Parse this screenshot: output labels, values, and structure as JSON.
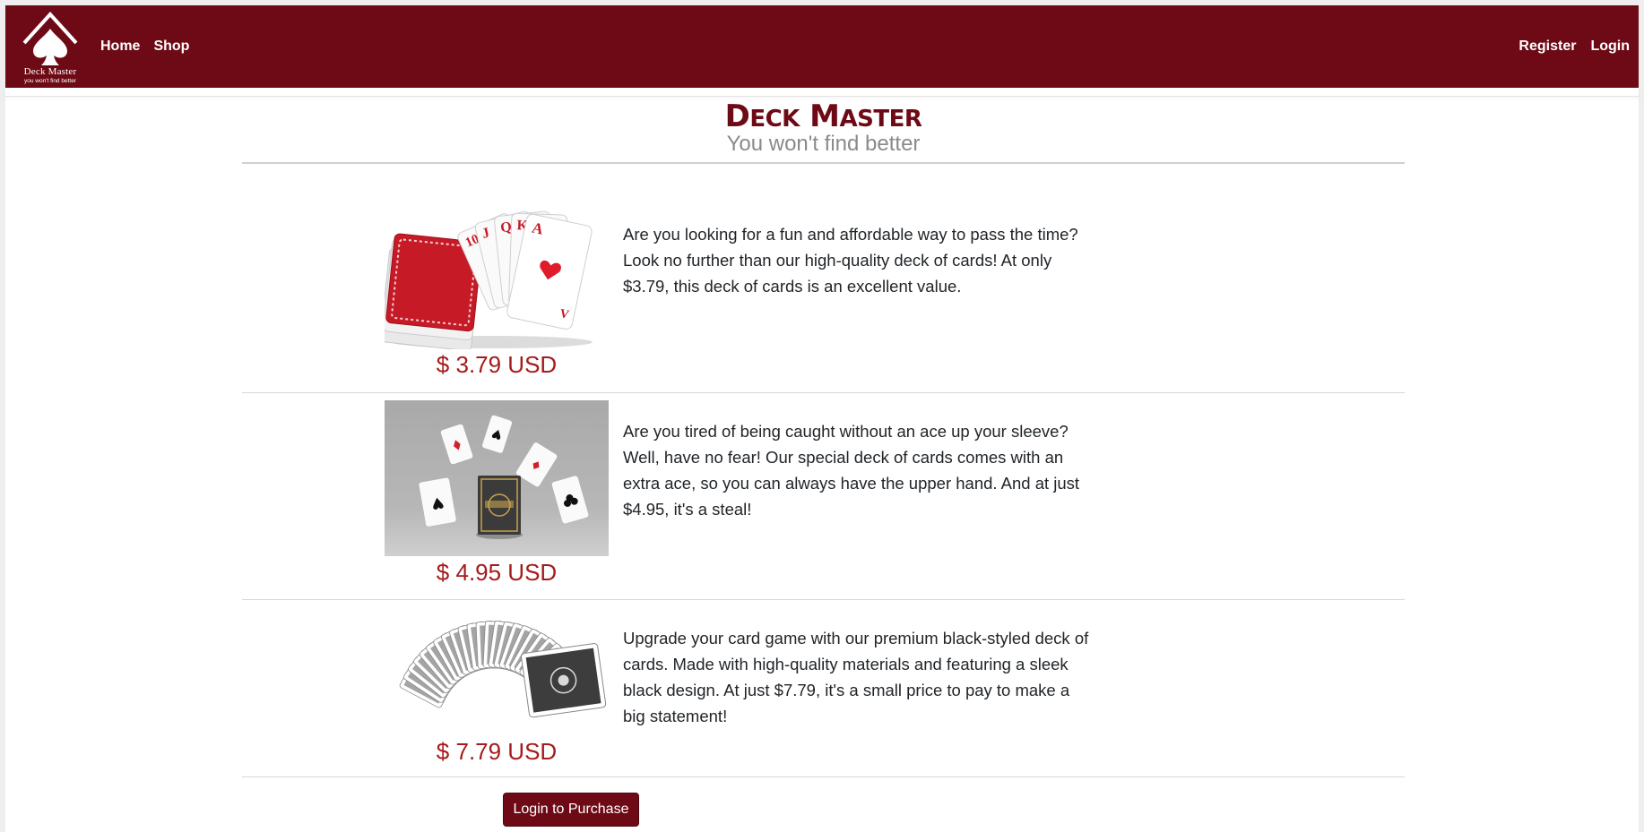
{
  "nav": {
    "brand_name": "Deck Master",
    "brand_tagline": "you won't find better",
    "left_links": [
      "Home",
      "Shop"
    ],
    "right_links": [
      "Register",
      "Login"
    ],
    "background": "#6e0a15"
  },
  "header": {
    "title_first_letter": "D",
    "title_first_rest": "ECK",
    "title_second_letter": "M",
    "title_second_rest": "ASTER",
    "subtitle": "You won't find better"
  },
  "products": [
    {
      "image_icon": "royal-flush-cards-image",
      "price": "$ 3.79 USD",
      "description": "Are you looking for a fun and affordable way to pass the time? Look no further than our high-quality deck of cards! At only $3.79, this deck of cards is an excellent value."
    },
    {
      "image_icon": "floating-aces-deck-image",
      "price": "$ 4.95 USD",
      "description": "Are you tired of being caught without an ace up your sleeve? Well, have no fear! Our special deck of cards comes with an extra ace, so you can always have the upper hand. And at just $4.95, it's a steal!"
    },
    {
      "image_icon": "fanned-black-deck-image",
      "price": "$ 7.79 USD",
      "description": "Upgrade your card game with our premium black-styled deck of cards. Made with high-quality materials and featuring a sleek black design. At just $7.79, it's a small price to pay to make a big statement!"
    }
  ],
  "purchase_button": "Login to Purchase",
  "colors": {
    "accent": "#6e0a15",
    "price": "#a51b1b",
    "subtitle": "#8a8a8a"
  }
}
